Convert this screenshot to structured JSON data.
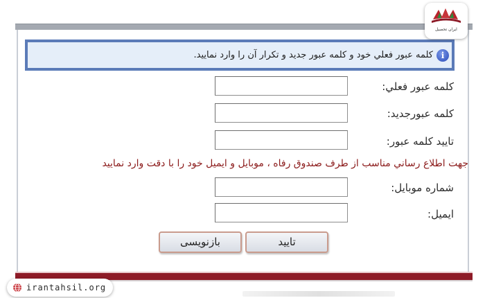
{
  "notice": {
    "icon": "info-icon",
    "text": "کلمه عبور فعلي خود و کلمه عبور جدید و تکرار آن را وارد نمایید."
  },
  "fields": {
    "current_password": {
      "label": "کلمه عبور فعلي:",
      "value": ""
    },
    "new_password": {
      "label": "کلمه عبورجدید:",
      "value": ""
    },
    "confirm_password": {
      "label": "تایید کلمه عبور:",
      "value": ""
    },
    "mobile": {
      "label": "شماره موبایل:",
      "value": ""
    },
    "email": {
      "label": "ایمیل:",
      "value": ""
    }
  },
  "contact_note": "جهت اطلاع رساني مناسب از طرف صندوق رفاه ، موبایل و ایمیل خود را با دقت وارد نمایید",
  "buttons": {
    "confirm": "تایید",
    "rewrite": "بازنویسی"
  },
  "branding": {
    "logo_text": "ایران تحصیل",
    "site_url": "irantahsil.org"
  },
  "colors": {
    "notice_border": "#5b7bb8",
    "notice_bg": "#e5eef9",
    "note_text": "#8b1a1a",
    "bottom_band": "#8e1b27",
    "button_border": "#c99b8d"
  }
}
